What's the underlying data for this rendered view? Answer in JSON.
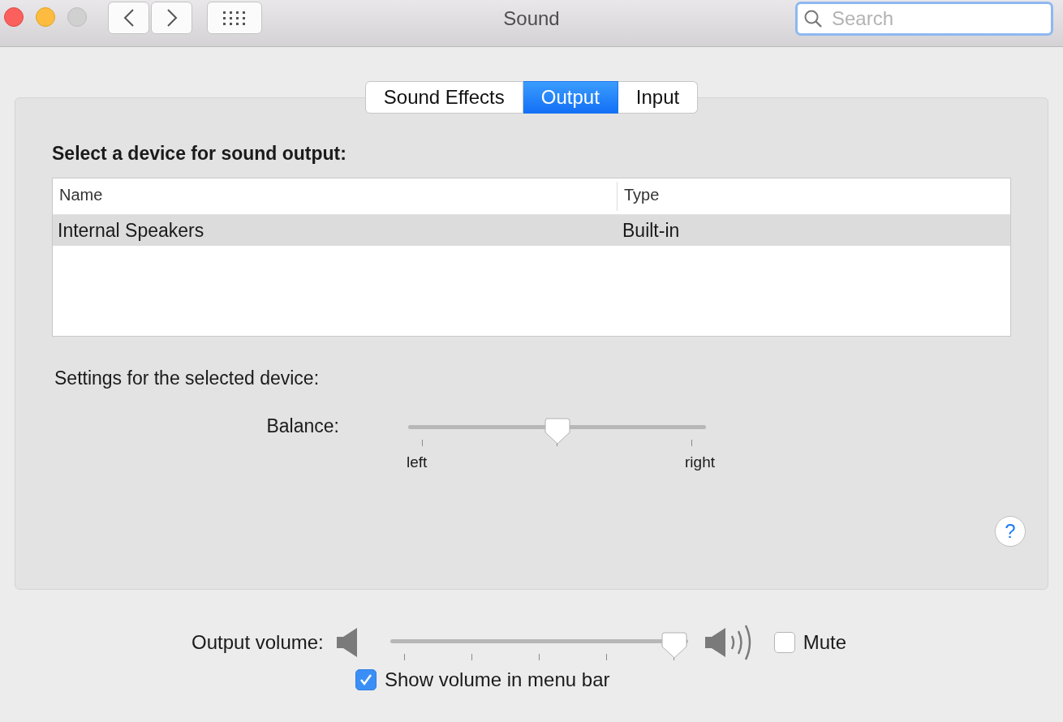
{
  "window": {
    "title": "Sound",
    "search": {
      "placeholder": "Search"
    }
  },
  "tabs": [
    {
      "label": "Sound Effects",
      "selected": false
    },
    {
      "label": "Output",
      "selected": true
    },
    {
      "label": "Input",
      "selected": false
    }
  ],
  "device_list": {
    "heading": "Select a device for sound output:",
    "columns": [
      "Name",
      "Type"
    ],
    "rows": [
      {
        "name": "Internal Speakers",
        "type": "Built-in",
        "selected": true
      }
    ]
  },
  "settings": {
    "heading": "Settings for the selected device:",
    "balance": {
      "label": "Balance:",
      "level": 0.5,
      "min_label": "left",
      "max_label": "right"
    }
  },
  "help_button": {
    "label": "?"
  },
  "output_volume": {
    "label": "Output volume:",
    "level": 1,
    "mute": {
      "label": "Mute",
      "checked": false
    }
  },
  "show_volume": {
    "label": "Show volume in menu bar",
    "checked": true
  }
}
